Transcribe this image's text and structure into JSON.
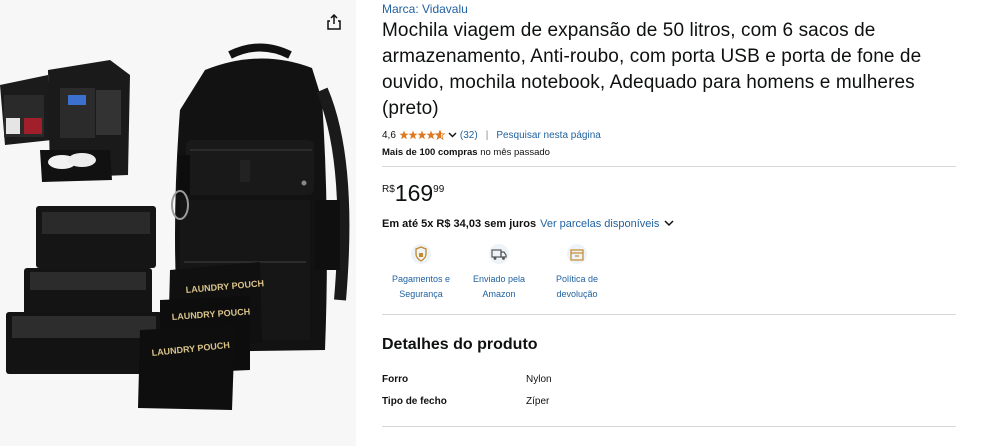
{
  "brand": "Marca: Vidavalu",
  "title": "Mochila viagem de expansão de 50 litros, com 6 sacos de armazenamento, Anti-roubo, com porta USB e porta de fone de ouvido, mochila notebook, Adequado para homens e mulheres (preto)",
  "rating": {
    "value": "4,6",
    "stars": 4.6,
    "count": "(32)",
    "separator": "|",
    "search_link": "Pesquisar nesta página"
  },
  "bought": {
    "bold": "Mais de 100 compras",
    "rest": "no mês passado"
  },
  "price": {
    "symbol": "R$",
    "whole": "169",
    "fraction": "99"
  },
  "installments": {
    "bold": "Em até 5x R$ 34,03 sem juros",
    "link": "Ver parcelas disponíveis"
  },
  "features": [
    {
      "icon": "shield-icon",
      "label_line1": "Pagamentos e",
      "label_line2": "Segurança"
    },
    {
      "icon": "truck-icon",
      "label_line1": "Enviado pela",
      "label_line2": "Amazon"
    },
    {
      "icon": "return-box-icon",
      "label_line1": "Política de",
      "label_line2": "devolução"
    }
  ],
  "details": {
    "title": "Detalhes do produto",
    "rows": [
      {
        "key": "Forro",
        "value": "Nylon"
      },
      {
        "key": "Tipo de fecho",
        "value": "Zíper"
      }
    ]
  },
  "colors": {
    "link": "#2162a1",
    "star": "#de7921",
    "text": "#0f1111",
    "divider": "#d5d9d9"
  },
  "image_text": {
    "pouch_label": "LAUNDRY POUCH"
  }
}
